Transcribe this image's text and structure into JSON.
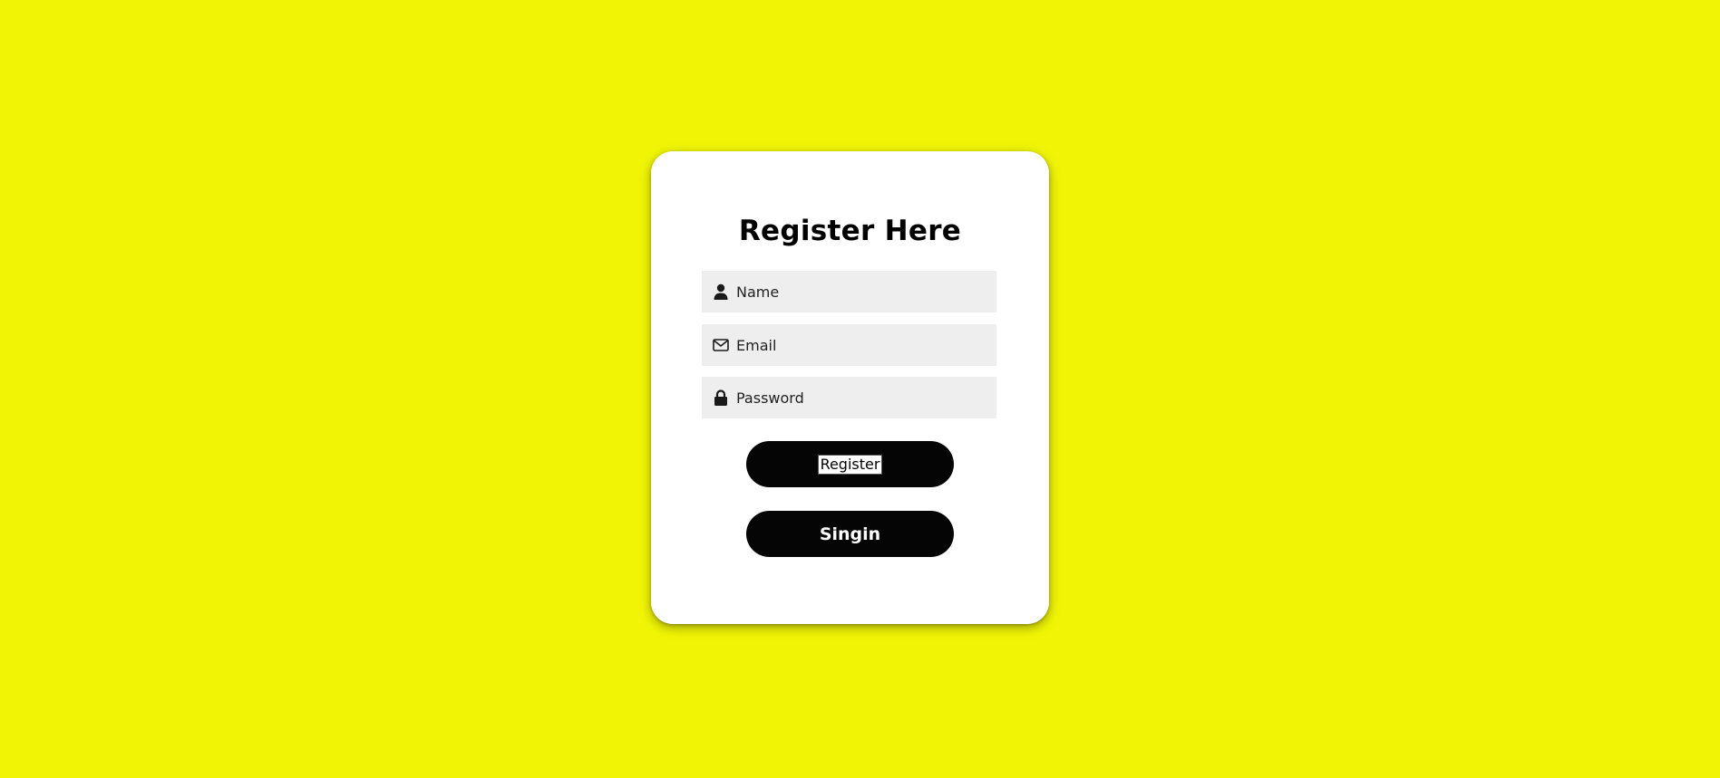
{
  "page": {
    "background_color": "#f1f505"
  },
  "form": {
    "title": "Register Here",
    "fields": [
      {
        "placeholder": "Name",
        "value": "",
        "icon": "user-icon"
      },
      {
        "placeholder": "Email",
        "value": "",
        "icon": "envelope-icon"
      },
      {
        "placeholder": "Password",
        "value": "",
        "icon": "lock-icon"
      }
    ],
    "register_label": "Register",
    "signin_label": "Singin"
  },
  "colors": {
    "card": "#ffffff",
    "field_bg": "#eeeeee",
    "button_bg": "#050505",
    "button_text": "#ffffff",
    "title_text": "#000000"
  }
}
